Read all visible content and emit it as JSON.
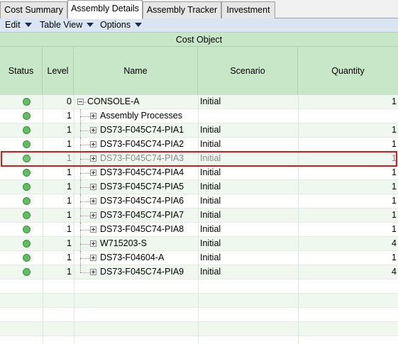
{
  "tabs": [
    {
      "label": "Cost Summary"
    },
    {
      "label": "Assembly Details"
    },
    {
      "label": "Assembly Tracker"
    },
    {
      "label": "Investment"
    }
  ],
  "active_tab": "Assembly Details",
  "toolbar": {
    "edit_label": "Edit",
    "table_view_label": "Table View",
    "options_label": "Options"
  },
  "grid": {
    "group_header": "Cost Object",
    "columns": {
      "status": "Status",
      "level": "Level",
      "name": "Name",
      "scenario": "Scenario",
      "quantity": "Quantity"
    },
    "rows": [
      {
        "level": "0",
        "name": "CONSOLE-A",
        "scenario": "Initial",
        "quantity": "1",
        "status": "green"
      },
      {
        "level": "1",
        "name": "Assembly Processes",
        "scenario": "",
        "quantity": "",
        "status": "green"
      },
      {
        "level": "1",
        "name": "DS73-F045C74-PIA1",
        "scenario": "Initial",
        "quantity": "1",
        "status": "green"
      },
      {
        "level": "1",
        "name": "DS73-F045C74-PIA2",
        "scenario": "Initial",
        "quantity": "1",
        "status": "green"
      },
      {
        "level": "1",
        "name": "DS73-F045C74-PIA3",
        "scenario": "Initial",
        "quantity": "1",
        "status": "green"
      },
      {
        "level": "1",
        "name": "DS73-F045C74-PIA4",
        "scenario": "Initial",
        "quantity": "1",
        "status": "green"
      },
      {
        "level": "1",
        "name": "DS73-F045C74-PIA5",
        "scenario": "Initial",
        "quantity": "1",
        "status": "green"
      },
      {
        "level": "1",
        "name": "DS73-F045C74-PIA6",
        "scenario": "Initial",
        "quantity": "1",
        "status": "green"
      },
      {
        "level": "1",
        "name": "DS73-F045C74-PIA7",
        "scenario": "Initial",
        "quantity": "1",
        "status": "green"
      },
      {
        "level": "1",
        "name": "DS73-F045C74-PIA8",
        "scenario": "Initial",
        "quantity": "1",
        "status": "green"
      },
      {
        "level": "1",
        "name": "W715203-S",
        "scenario": "Initial",
        "quantity": "4",
        "status": "green"
      },
      {
        "level": "1",
        "name": "DS73-F04604-A",
        "scenario": "Initial",
        "quantity": "1",
        "status": "green"
      },
      {
        "level": "1",
        "name": "DS73-F045C74-PIA9",
        "scenario": "Initial",
        "quantity": "4",
        "status": "green"
      }
    ]
  },
  "colors": {
    "header_bg": "#c8e6c8",
    "status_ok": "#5fbf5f",
    "highlight": "#d61a1a"
  }
}
